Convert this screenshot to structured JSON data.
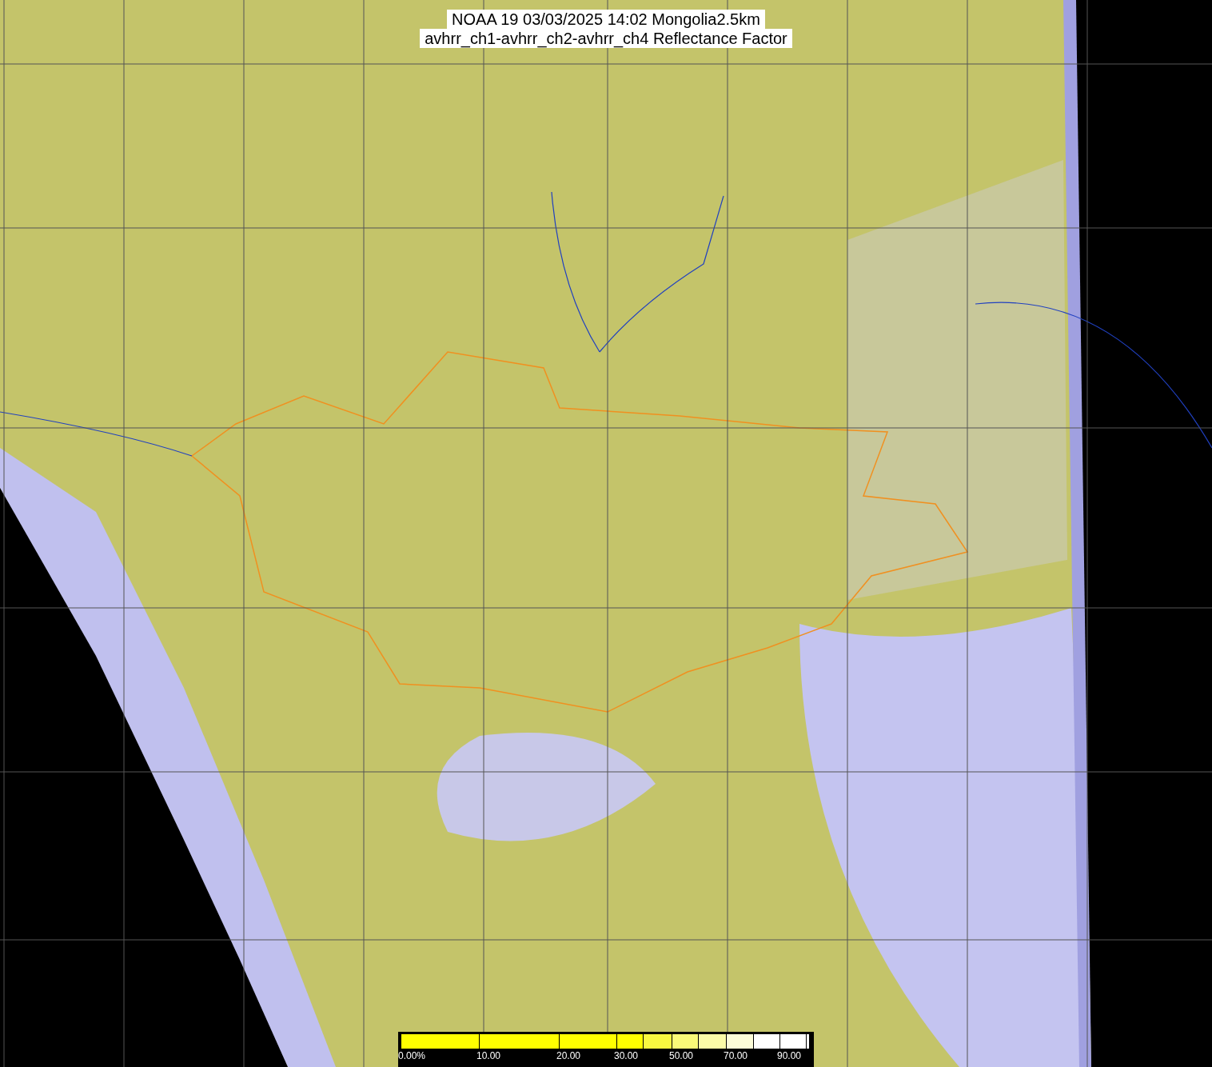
{
  "title": {
    "lines": [
      "NOAA 19 03/03/2025 14:02 Mongolia2.5km",
      "avhrr_ch1-avhrr_ch2-avhrr_ch4 Reflectance Factor"
    ]
  },
  "colorbar": {
    "segments": [
      {
        "color": "#ffff00",
        "label": "0.00%"
      },
      {
        "color": "#ffff00",
        "label": "10.00"
      },
      {
        "color": "#ffff00",
        "label": "20.00"
      },
      {
        "color": "#ffff00",
        "label": "30.00"
      },
      {
        "color": "#f8f840"
      },
      {
        "color": "#fafa78",
        "label": "50.00"
      },
      {
        "color": "#fbfba8"
      },
      {
        "color": "#fcfcd8",
        "label": "70.00"
      },
      {
        "color": "#ffffff"
      },
      {
        "color": "#ffffff",
        "label": "90.00"
      },
      {
        "color": "#ffffff"
      }
    ]
  }
}
